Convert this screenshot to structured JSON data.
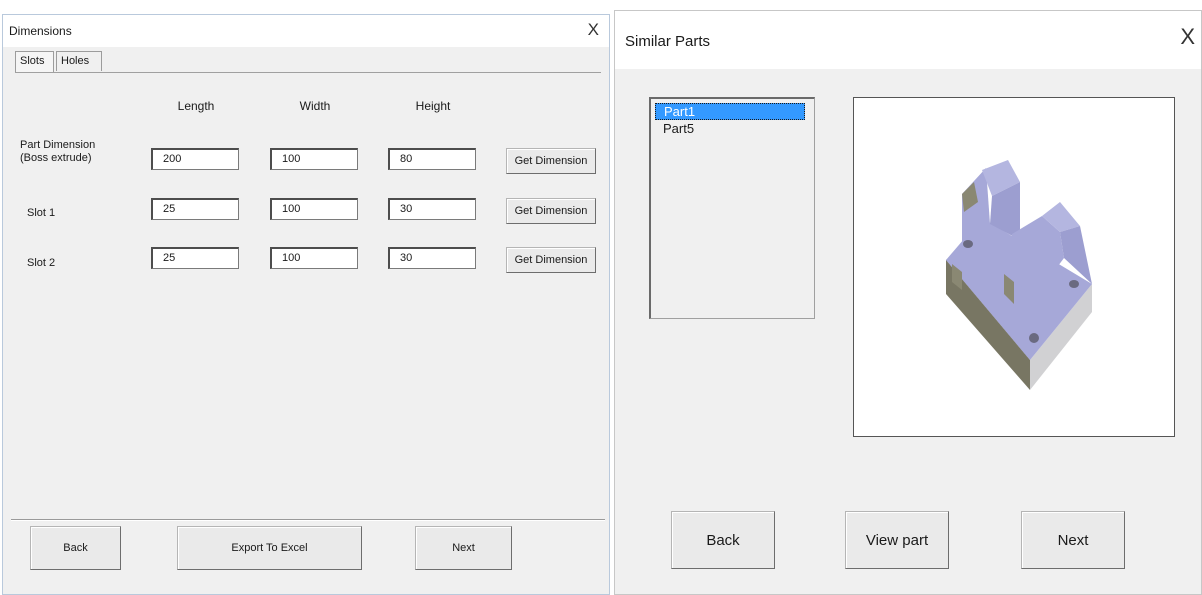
{
  "dimensions_window": {
    "title": "Dimensions",
    "close": "X",
    "tabs": [
      {
        "label": "Slots"
      },
      {
        "label": "Holes"
      }
    ],
    "columns": [
      "Length",
      "Width",
      "Height"
    ],
    "rows": [
      {
        "label_line1": "Part Dimension",
        "label_line2": "(Boss extrude)",
        "values": [
          "200",
          "100",
          "80"
        ],
        "button": "Get Dimension"
      },
      {
        "label_line1": "Slot 1",
        "label_line2": "",
        "values": [
          "25",
          "100",
          "30"
        ],
        "button": "Get Dimension"
      },
      {
        "label_line1": "Slot 2",
        "label_line2": "",
        "values": [
          "25",
          "100",
          "30"
        ],
        "button": "Get Dimension"
      }
    ],
    "footer": {
      "back": "Back",
      "export": "Export To Excel",
      "next": "Next"
    }
  },
  "similar_parts_window": {
    "title": "Similar Parts",
    "close": "X",
    "parts": [
      {
        "name": "Part1",
        "selected": true
      },
      {
        "name": "Part5",
        "selected": false
      }
    ],
    "footer": {
      "back": "Back",
      "view": "View part",
      "next": "Next"
    },
    "model_colors": {
      "top": "#a6a8d8",
      "left": "#787663",
      "right": "#d1d1d3"
    }
  }
}
